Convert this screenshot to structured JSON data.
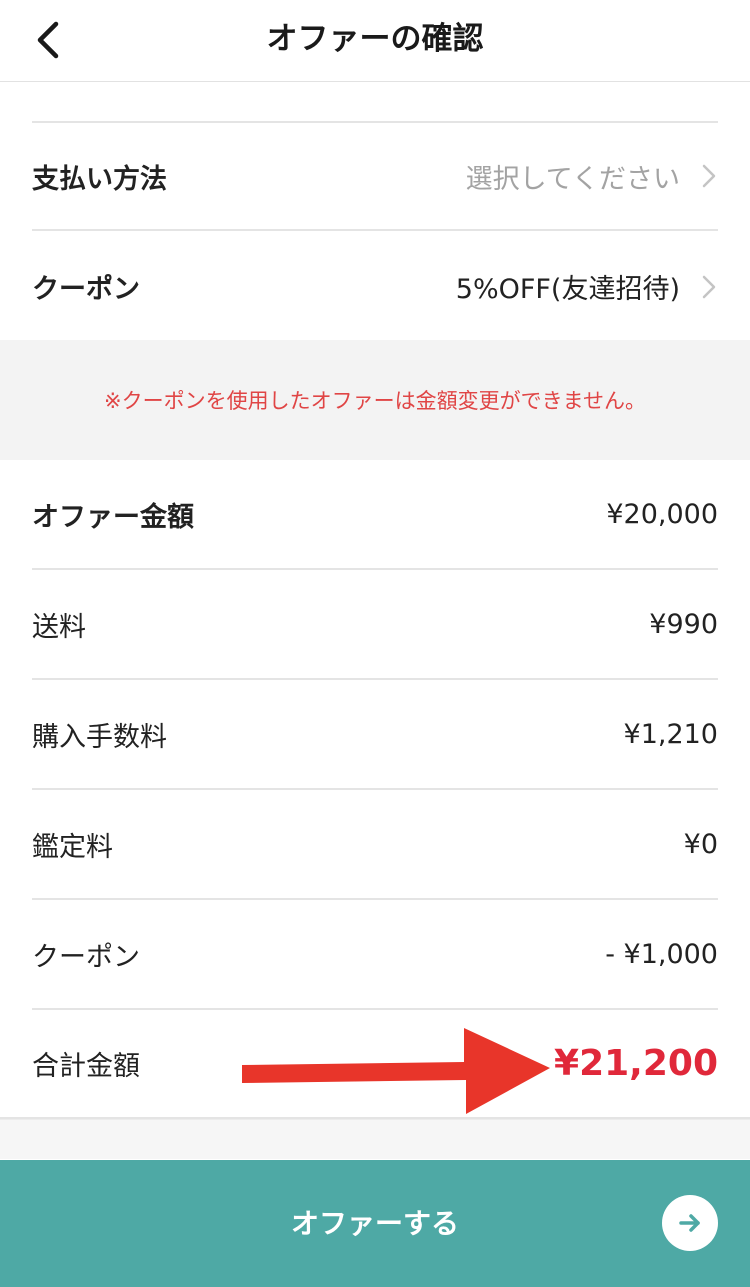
{
  "header": {
    "title": "オファーの確認"
  },
  "selection_rows": [
    {
      "label": "支払い方法",
      "value": "選択してください",
      "muted": true
    },
    {
      "label": "クーポン",
      "value": "5%OFF(友達招待)",
      "muted": false
    }
  ],
  "notice": {
    "text": "※クーポンを使用したオファーは金額変更ができません。"
  },
  "price_rows": [
    {
      "label": "オファー金額",
      "value": "¥20,000"
    },
    {
      "label": "送料",
      "value": "¥990"
    },
    {
      "label": "購入手数料",
      "value": "¥1,210"
    },
    {
      "label": "鑑定料",
      "value": "¥0"
    },
    {
      "label": "クーポン",
      "value": "- ¥1,000"
    }
  ],
  "total": {
    "label": "合計金額",
    "value": "¥21,200"
  },
  "submit_button": {
    "label": "オファーする"
  },
  "colors": {
    "accent": "#4ea9a5",
    "total_red": "#e0283a",
    "notice_red": "#e04545",
    "annotation_arrow": "#e8352a"
  },
  "icons": {
    "back": "chevron-left-icon",
    "row_chevron": "chevron-right-icon",
    "submit": "arrow-right-icon"
  }
}
